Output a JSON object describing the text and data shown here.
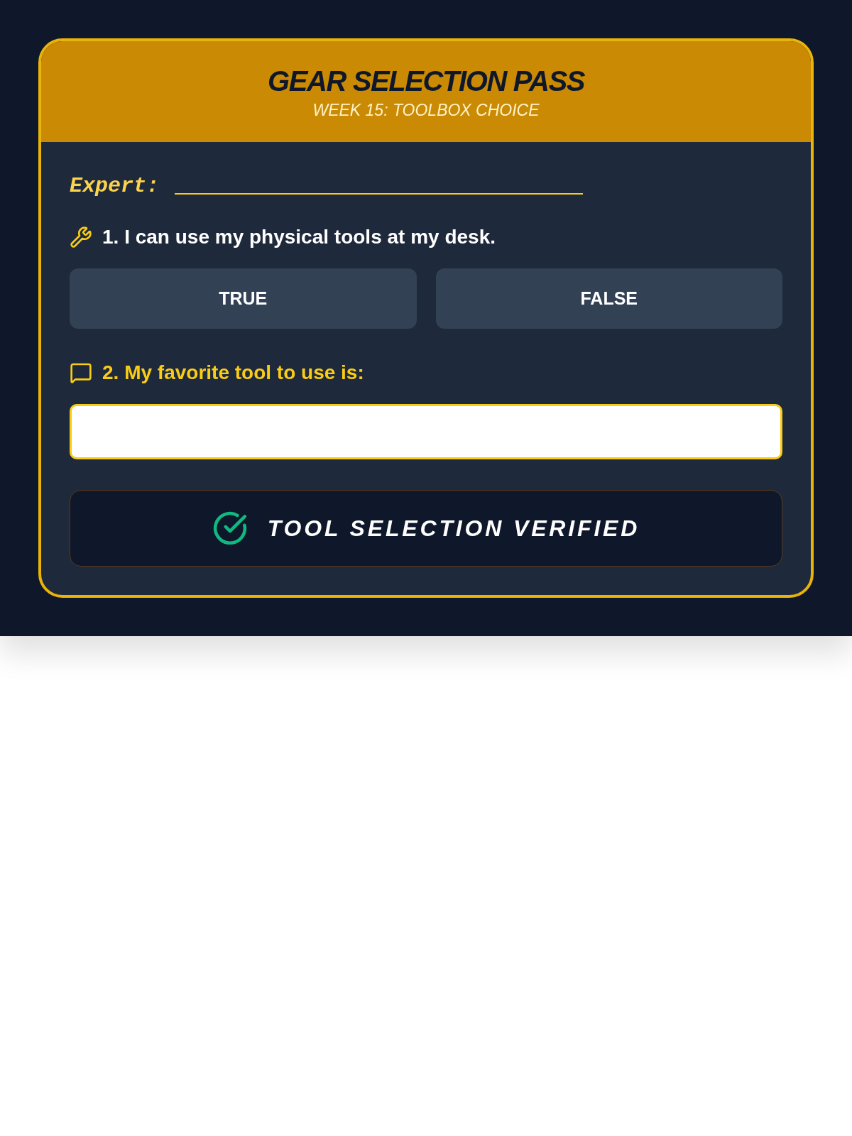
{
  "header": {
    "title": "GEAR SELECTION PASS",
    "subtitle": "WEEK 15: TOOLBOX CHOICE"
  },
  "name_field": {
    "label": "Expert:"
  },
  "questions": [
    {
      "kind": "true_false",
      "text": "1. I can use my physical tools at my desk.",
      "options": [
        {
          "label": "TRUE",
          "selected": false
        },
        {
          "label": "FALSE",
          "selected": false
        }
      ]
    },
    {
      "kind": "short_answer",
      "text": "2. My favorite tool to use is:"
    }
  ],
  "status": {
    "text": "TOOL SELECTION VERIFIED",
    "verified": true
  }
}
